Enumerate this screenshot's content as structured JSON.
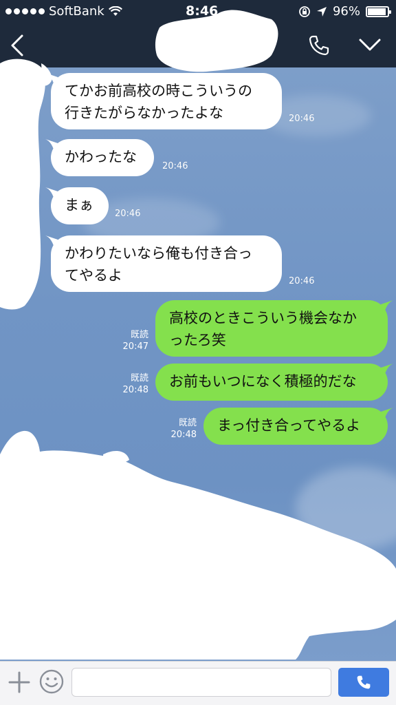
{
  "status_bar": {
    "carrier": "SoftBank",
    "time": "8:46",
    "battery": "96%",
    "signal_dots": 5
  },
  "header": {
    "back_icon": "chevron-left-icon",
    "call_icon": "phone-icon",
    "menu_icon": "chevron-down-icon"
  },
  "messages": [
    {
      "side": "left",
      "lines": [
        "てかお前高校の時こういうの",
        "行きたがらなかったよな"
      ],
      "time": "20:46"
    },
    {
      "side": "left",
      "lines": [
        "かわったな"
      ],
      "time": "20:46"
    },
    {
      "side": "left",
      "lines": [
        "まぁ"
      ],
      "time": "20:46"
    },
    {
      "side": "left",
      "lines": [
        "かわりたいなら俺も付き合っ",
        "てやるよ"
      ],
      "time": "20:46"
    },
    {
      "side": "right",
      "lines": [
        "高校のときこういう機会なか",
        "ったろ笑"
      ],
      "read": "既読",
      "time": "20:47"
    },
    {
      "side": "right",
      "lines": [
        "お前もいつになく積極的だな"
      ],
      "read": "既読",
      "time": "20:48"
    },
    {
      "side": "right",
      "lines": [
        "まっ付き合ってやるよ"
      ],
      "read": "既読",
      "time": "20:48"
    }
  ],
  "input_bar": {
    "plus_icon": "plus-icon",
    "emoji_icon": "emoji-icon",
    "placeholder": "",
    "send_icon": "phone-icon"
  },
  "colors": {
    "header_bg": "#1e2a3b",
    "chat_bg": "#7195c5",
    "left_bubble": "#ffffff",
    "right_bubble": "#84e04d",
    "send_button": "#3f7be0"
  }
}
